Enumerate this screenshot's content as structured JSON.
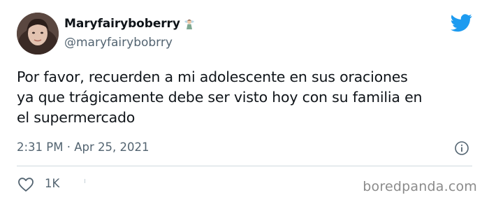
{
  "author": {
    "display_name": "Maryfairyboberry",
    "name_emoji_icon": "fairy-emoji",
    "handle": "@maryfairybobrry"
  },
  "tweet": {
    "lines": [
      "Por favor, recuerden a mi adolescente en sus oraciones",
      "ya que trágicamente debe ser visto hoy con su familia en",
      "el supermercado"
    ],
    "timestamp": "2:31 PM · Apr 25, 2021"
  },
  "actions": {
    "like_count": "1K",
    "like_icon": "heart-icon",
    "info_icon": "info-icon"
  },
  "brand": {
    "icon": "twitter-bird-icon",
    "color": "#1d9bf0"
  },
  "watermark": "boredpanda.com"
}
